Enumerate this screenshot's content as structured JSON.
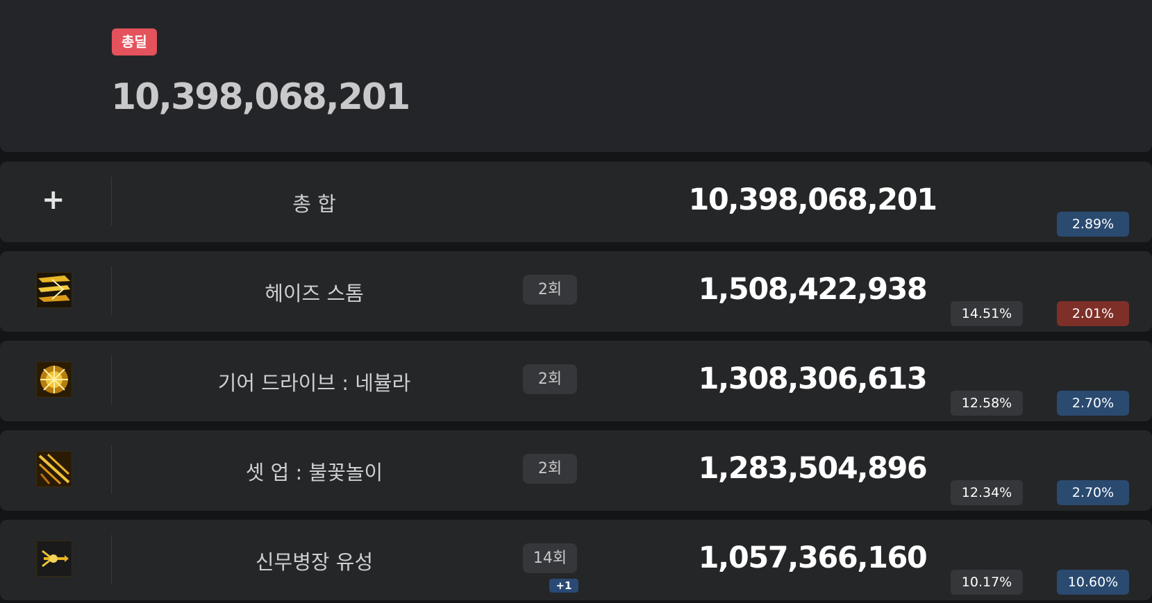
{
  "header": {
    "badge": "총딜",
    "total": "10,398,068,201"
  },
  "summary": {
    "icon": "plus-icon",
    "name": "총 합",
    "damage": "10,398,068,201",
    "rate": "2.89%",
    "rate_color": "#2a4a70"
  },
  "skills": [
    {
      "name": "헤이즈 스톰",
      "hits": "2회",
      "damage": "1,508,422,938",
      "share": "14.51%",
      "rate": "2.01%",
      "rate_color": "#7e3028",
      "icon": "haze-storm-skill-icon"
    },
    {
      "name": "기어 드라이브 : 네뷸라",
      "hits": "2회",
      "damage": "1,308,306,613",
      "share": "12.58%",
      "rate": "2.70%",
      "rate_color": "#2a4a70",
      "icon": "gear-drive-nebula-skill-icon"
    },
    {
      "name": "셋 업 : 불꽃놀이",
      "hits": "2회",
      "damage": "1,283,504,896",
      "share": "12.34%",
      "rate": "2.70%",
      "rate_color": "#2a4a70",
      "icon": "setup-fireworks-skill-icon"
    },
    {
      "name": "신무병장 유성",
      "hits": "14회",
      "extra": "+1",
      "damage": "1,057,366,160",
      "share": "10.17%",
      "rate": "10.60%",
      "rate_color": "#2a4a70",
      "icon": "shinmu-meteor-skill-icon"
    }
  ]
}
